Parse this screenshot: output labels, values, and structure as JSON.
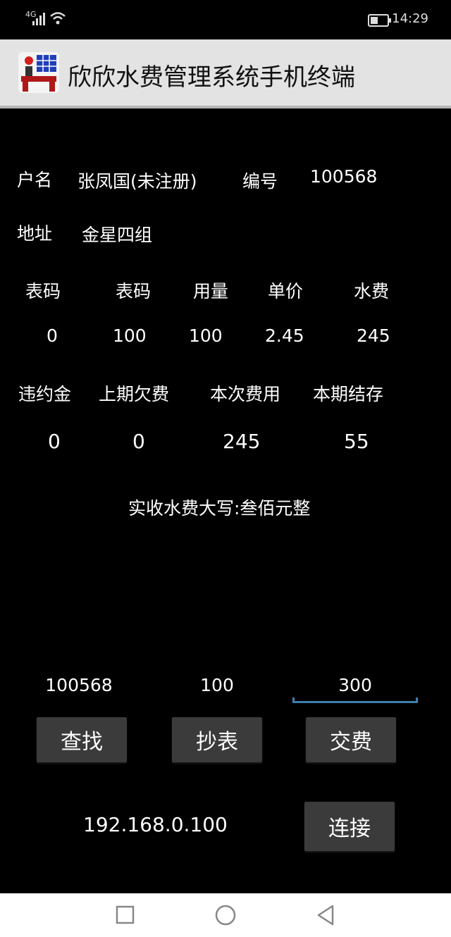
{
  "status_bar": {
    "network": "4G",
    "time": "14:29"
  },
  "app": {
    "title": "欣欣水费管理系统手机终端"
  },
  "customer": {
    "name_label": "户名",
    "name": "张凤国(未注册)",
    "id_label": "编号",
    "id": "100568",
    "address_label": "地址",
    "address": "金星四组"
  },
  "reading": {
    "headers": [
      "表码",
      "表码",
      "用量",
      "单价",
      "水费"
    ],
    "values": [
      "0",
      "100",
      "100",
      "2.45",
      "245"
    ]
  },
  "billing": {
    "headers": [
      "违约金",
      "上期欠费",
      "本次费用",
      "本期结存"
    ],
    "values": [
      "0",
      "0",
      "245",
      "55"
    ]
  },
  "amount_text": "实收水费大写:叁佰元整",
  "inputs": {
    "account": "100568",
    "meter": "100",
    "payment": "300"
  },
  "buttons": {
    "search": "查找",
    "read_meter": "抄表",
    "pay": "交费",
    "connect": "连接"
  },
  "server_ip": "192.168.0.100",
  "colors": {
    "background": "#000000",
    "title_bar": "#e3e3e3",
    "button": "#3b3b3b",
    "accent": "#3d7fb0"
  }
}
